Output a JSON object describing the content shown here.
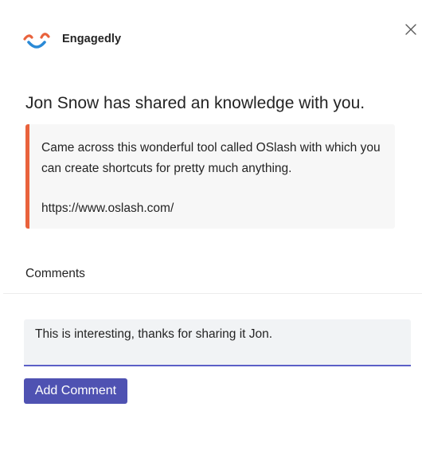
{
  "app": {
    "name": "Engagedly",
    "logo_icon": "engagedly-logo-icon",
    "close_icon": "close-icon",
    "colors": {
      "accent": "#5b5fc7",
      "button": "#4f52b2",
      "quote_border": "#e9623c",
      "logo_orange": "#e9623c",
      "logo_blue": "#2b8ad6"
    }
  },
  "notification": {
    "headline": "Jon Snow has shared an knowledge with you.",
    "message": "Came across this wonderful tool called OSlash with which you can create shortcuts for pretty much anything.",
    "link": "https://www.oslash.com/"
  },
  "comments": {
    "label": "Comments",
    "input_value": "This is interesting, thanks for sharing it Jon.",
    "add_button_label": "Add Comment"
  }
}
